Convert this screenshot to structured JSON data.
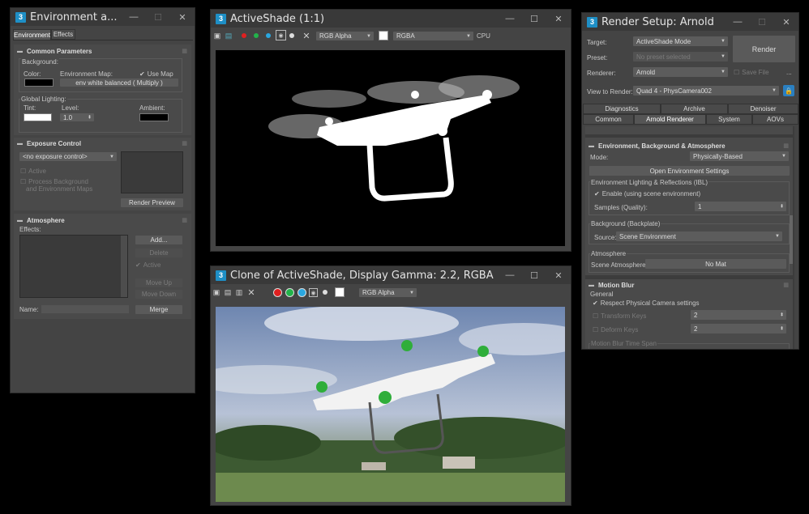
{
  "env_window": {
    "title": "Environment a...",
    "tabs": [
      "Environment",
      "Effects"
    ],
    "common": {
      "header": "Common Parameters",
      "background": "Background:",
      "color": "Color:",
      "env_map": "Environment Map:",
      "use_map": "Use Map",
      "map_button": "env white balanced  ( Multiply )",
      "global_lighting": "Global Lighting:",
      "tint": "Tint:",
      "level": "Level:",
      "level_value": "1.0",
      "ambient": "Ambient:"
    },
    "exposure": {
      "header": "Exposure Control",
      "dropdown": "<no exposure control>",
      "active": "Active",
      "process_bg_1": "Process Background",
      "process_bg_2": "and Environment Maps",
      "render_preview": "Render Preview"
    },
    "atmosphere": {
      "header": "Atmosphere",
      "effects": "Effects:",
      "add": "Add...",
      "delete": "Delete",
      "active": "Active",
      "move_up": "Move Up",
      "move_down": "Move Down",
      "name": "Name:",
      "merge": "Merge"
    }
  },
  "activeshade": {
    "title": "ActiveShade (1:1)",
    "channel": "RGB Alpha",
    "mode": "RGBA",
    "device": "CPU"
  },
  "clone": {
    "title": "Clone of ActiveShade, Display Gamma: 2.2, RGBA ...",
    "channel": "RGB Alpha"
  },
  "render_setup": {
    "title": "Render Setup: Arnold",
    "target_label": "Target:",
    "target": "ActiveShade Mode",
    "preset_label": "Preset:",
    "preset": "No preset selected",
    "renderer_label": "Renderer:",
    "renderer": "Arnold",
    "save_file": "Save File",
    "render": "Render",
    "more": "...",
    "view_label": "View to Render:",
    "view": "Quad 4 - PhysCamera002",
    "tabs_row1": [
      "Diagnostics",
      "Archive",
      "Denoiser"
    ],
    "tabs_row2": [
      "Common",
      "Arnold Renderer",
      "System",
      "AOVs"
    ],
    "env": {
      "header": "Environment, Background & Atmosphere",
      "mode_label": "Mode:",
      "mode": "Physically-Based",
      "open_env": "Open Environment Settings",
      "ibl_group": "Environment Lighting & Reflections (IBL)",
      "enable": "Enable (using scene environment)",
      "samples_label": "Samples (Quality):",
      "samples": "1",
      "bg_group": "Background (Backplate)",
      "source_label": "Source:",
      "source": "Scene Environment",
      "atm_group": "Atmosphere",
      "scene_atm_label": "Scene Atmosphere:",
      "scene_atm": "No Mat"
    },
    "motion": {
      "header": "Motion Blur",
      "general": "General",
      "respect": "Respect Physical Camera settings",
      "transform": "Transform Keys",
      "transform_val": "2",
      "deform": "Deform Keys",
      "deform_val": "2",
      "time_span": "Motion Blur Time Span"
    }
  },
  "colors": {
    "window_bg": "#444444",
    "title_bg": "#393939",
    "accent": "#1e8fc6"
  }
}
